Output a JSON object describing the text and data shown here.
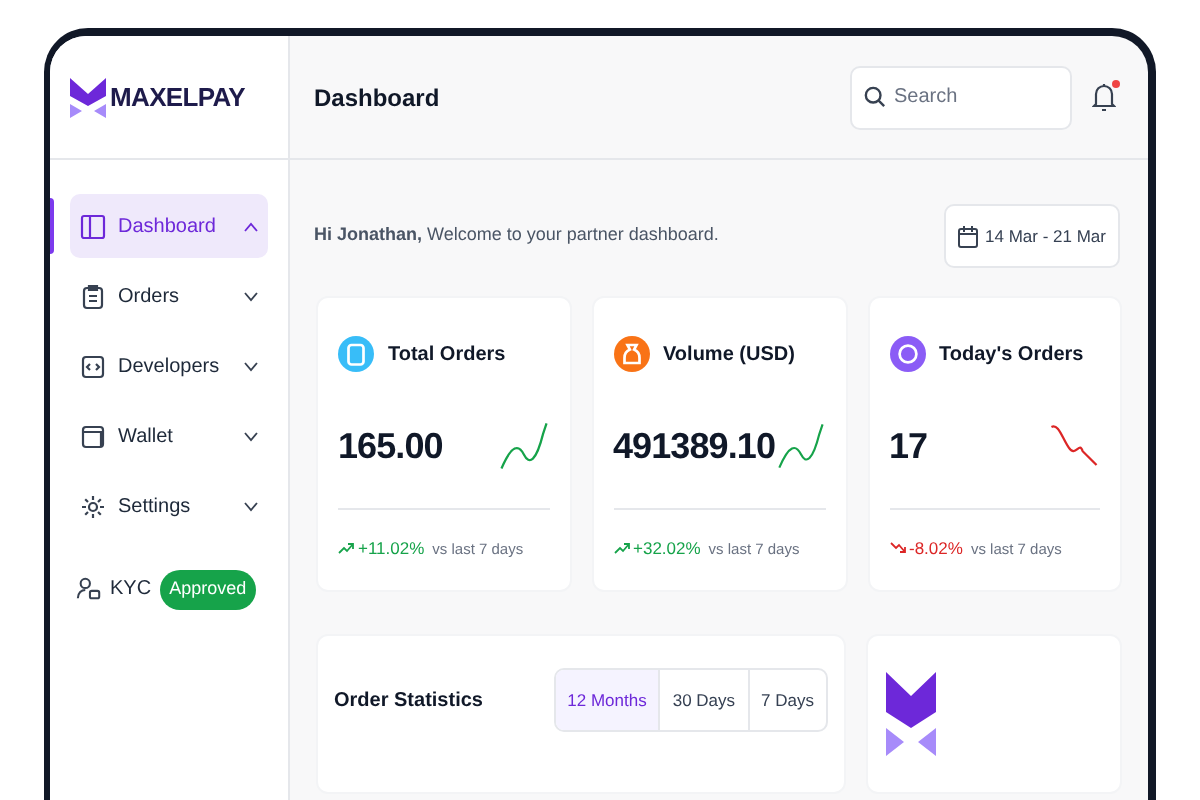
{
  "brand": {
    "name": "MAXELPAY"
  },
  "sidebar": {
    "items": [
      {
        "label": "Dashboard",
        "selected": true,
        "expanded": true
      },
      {
        "label": "Orders",
        "selected": false,
        "expanded": false
      },
      {
        "label": "Developers",
        "selected": false,
        "expanded": false
      },
      {
        "label": "Wallet",
        "selected": false,
        "expanded": false
      },
      {
        "label": "Settings",
        "selected": false,
        "expanded": false
      }
    ],
    "kyc": {
      "label": "KYC",
      "badge": "Approved"
    }
  },
  "header": {
    "title": "Dashboard",
    "search": {
      "placeholder": "Search"
    },
    "notifications_unread": true
  },
  "greeting": "**Hi Jonathan,** Welcome to your partner dashboard.",
  "date_range": "14 Mar - 21 Mar",
  "stats": [
    {
      "title": "Total Orders",
      "value": "165.00",
      "change": "+11.02%",
      "kind": "up",
      "comparison": "vs last 7 days",
      "color": "#38bdf8"
    },
    {
      "title": "Volume (USD)",
      "value": "491389.10",
      "change": "+32.02%",
      "kind": "up",
      "comparison": "vs last 7 days",
      "color": "#f97316"
    },
    {
      "title": "Today's Orders",
      "value": "17",
      "change": "-8.02%",
      "kind": "down",
      "comparison": "vs last 7 days",
      "color": "#8b5cf6"
    }
  ],
  "order_statistics": {
    "title": "Order Statistics",
    "periods": [
      {
        "label": "12 Months",
        "selected": true
      },
      {
        "label": "30 Days",
        "selected": false
      },
      {
        "label": "7 Days",
        "selected": false
      }
    ]
  }
}
